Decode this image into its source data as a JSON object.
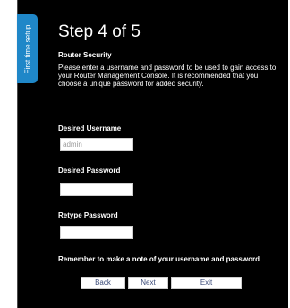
{
  "side_tab": {
    "label": "First time setup",
    "color": "#1f87c8"
  },
  "wizard": {
    "title": "Step 4 of 5",
    "section_heading": "Router Security",
    "description": "Please enter a username and password to be used to gain access to your Router Management Console. It is recommended that you choose a unique password for added security.",
    "username": {
      "label": "Desired Username",
      "value": "",
      "placeholder": "admin"
    },
    "password": {
      "label": "Desired Password",
      "value": ""
    },
    "retype_password": {
      "label": "Retype Password",
      "value": ""
    },
    "note": "Remember to make a note of your username and password"
  },
  "buttons": {
    "back": "Back",
    "next": "Next",
    "exit": "Exit"
  },
  "colors": {
    "background": "#000000",
    "text": "#ffffff",
    "button_text": "#3a4a78"
  }
}
